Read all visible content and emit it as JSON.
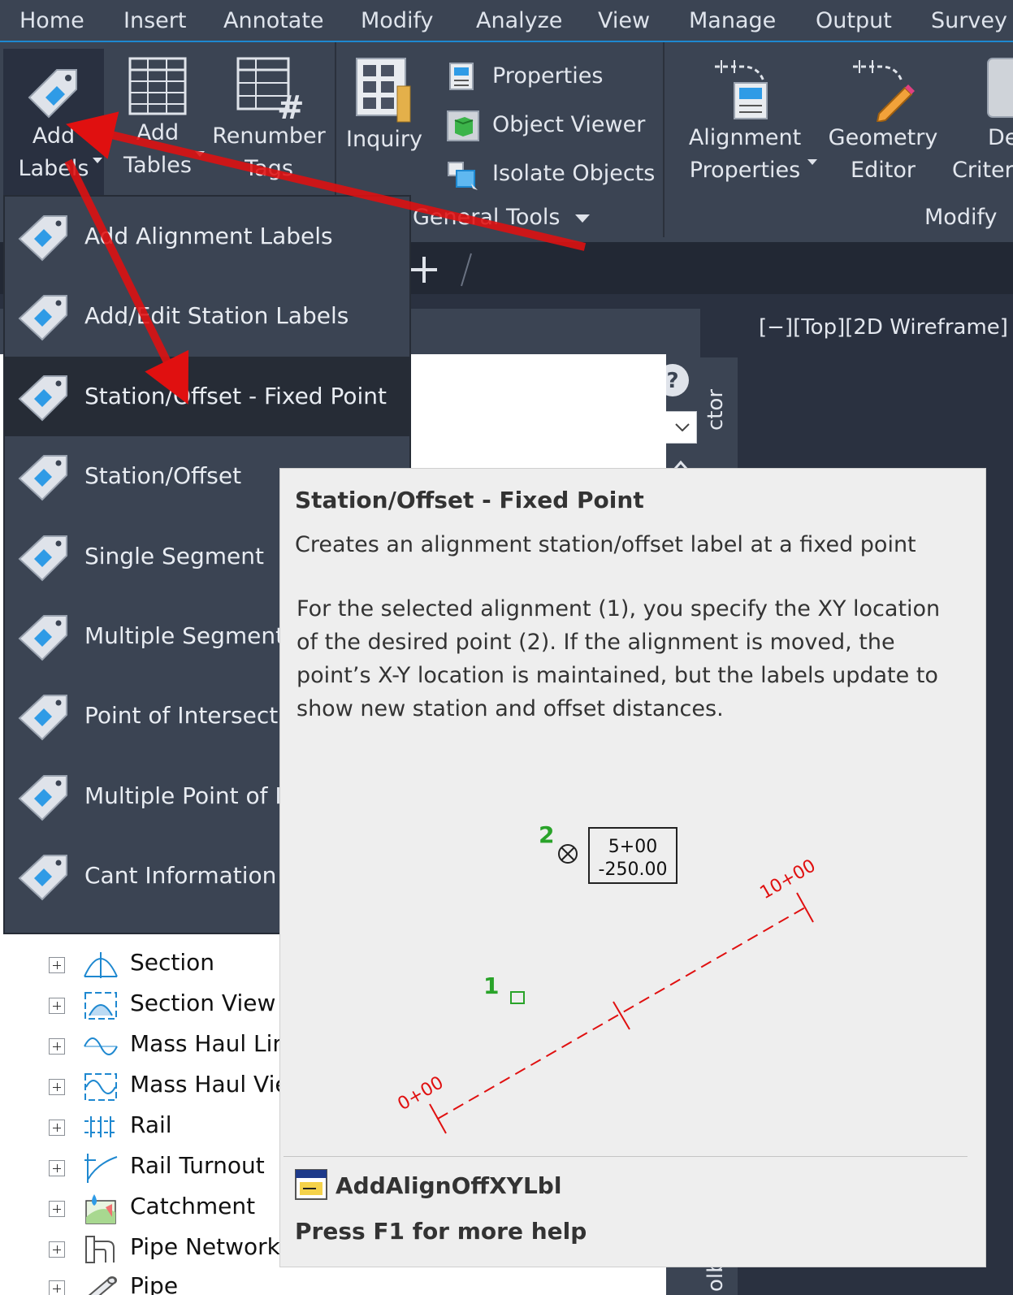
{
  "menubar": {
    "items": [
      "Home",
      "Insert",
      "Annotate",
      "Modify",
      "Analyze",
      "View",
      "Manage",
      "Output",
      "Survey"
    ]
  },
  "ribbon": {
    "add_labels": [
      "Add",
      "Labels"
    ],
    "add_tables": [
      "Add",
      "Tables"
    ],
    "renumber_tags": [
      "Renumber",
      "Tags"
    ],
    "inquiry": "Inquiry",
    "properties": "Properties",
    "object_viewer": "Object Viewer",
    "isolate_objects": "Isolate Objects",
    "general_tools": "General Tools",
    "alignment_properties": [
      "Alignment",
      "Properties"
    ],
    "geometry_editor": [
      "Geometry",
      "Editor"
    ],
    "design_criteria": [
      "De",
      "Criteri"
    ],
    "modify_panel": "Modify"
  },
  "viewport": {
    "label": "[−][Top][2D Wireframe]"
  },
  "palette": {
    "vertical_tab": "ctor",
    "vertical_tab2": "olb"
  },
  "dropdown": {
    "items": [
      "Add Alignment Labels",
      "Add/Edit Station Labels",
      "Station/Offset - Fixed Point",
      "Station/Offset",
      "Single Segment",
      "Multiple Segment",
      "Point of Intersection",
      "Multiple Point of Intersection",
      "Cant Information"
    ]
  },
  "tree": {
    "items": [
      "Section",
      "Section View",
      "Mass Haul Line",
      "Mass Haul View",
      "Rail",
      "Rail Turnout",
      "Catchment",
      "Pipe Network",
      "Pipe"
    ]
  },
  "tooltip": {
    "title": "Station/Offset - Fixed Point",
    "subtitle": "Creates an alignment station/offset label at a fixed point",
    "body": "For the selected alignment (1), you specify the XY location of the desired point (2). If the alignment is moved, the point’s X-Y location is maintained, but the labels update to show new station and offset distances.",
    "diagram": {
      "station_start": "0+00",
      "station_end": "10+00",
      "marker_1": "1",
      "marker_2": "2",
      "label_station": "5+00",
      "label_offset": "-250.00"
    },
    "command": "AddAlignOffXYLbl",
    "help": "Press F1 for more help"
  },
  "colors": {
    "ribbon_bg": "#3b4453",
    "accent_blue": "#1e88d0",
    "annotation_red": "#e01010",
    "tooltip_bg": "#eeeeee"
  }
}
